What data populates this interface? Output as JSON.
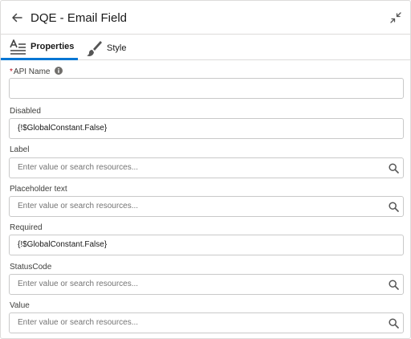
{
  "header": {
    "title": "DQE - Email Field",
    "back_icon": "back-arrow-icon",
    "collapse_icon": "collapse-icon"
  },
  "tabs": [
    {
      "label": "Properties",
      "icon": "properties-icon",
      "active": true
    },
    {
      "label": "Style",
      "icon": "brush-icon",
      "active": false
    }
  ],
  "fields": {
    "api_name": {
      "label": "API Name",
      "required": "*",
      "value": "",
      "info_icon": "info-icon"
    },
    "disabled": {
      "label": "Disabled",
      "value": "{!$GlobalConstant.False}"
    },
    "label": {
      "label": "Label",
      "placeholder": "Enter value or search resources..."
    },
    "placeholder_text": {
      "label": "Placeholder text",
      "placeholder": "Enter value or search resources..."
    },
    "required": {
      "label": "Required",
      "value": "{!$GlobalConstant.False}"
    },
    "status_code": {
      "label": "StatusCode",
      "placeholder": "Enter value or search resources..."
    },
    "value": {
      "label": "Value",
      "placeholder": "Enter value or search resources..."
    }
  },
  "colors": {
    "accent": "#0176d3",
    "required": "#ba0517",
    "border": "#c9c9c9"
  }
}
